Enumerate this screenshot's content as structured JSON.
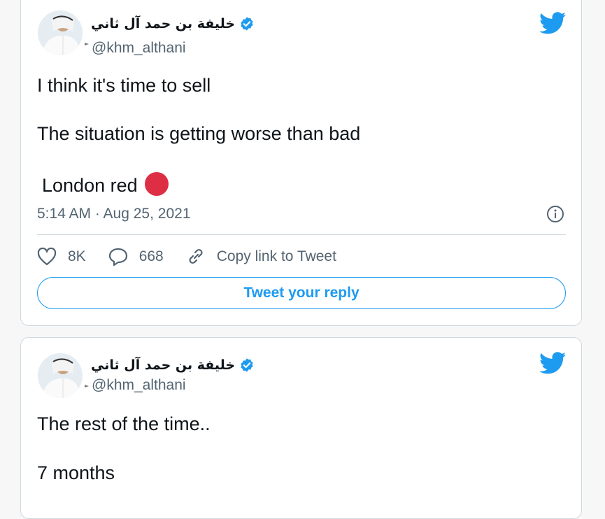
{
  "colors": {
    "accent": "#1d9bf0",
    "muted": "#536471",
    "red_circle": "#dd2e44"
  },
  "tweets": [
    {
      "author_name": "خليفة بن حمد آل ثاني",
      "handle": "@khm_althani",
      "lines": [
        "I think it's time to sell",
        "The situation is getting worse than bad",
        "London red"
      ],
      "emoji": "red-circle-emoji",
      "timestamp": "5:14 AM · Aug 25, 2021",
      "likes": "8K",
      "replies": "668",
      "copy_link_label": "Copy link to Tweet",
      "reply_button_label": "Tweet your reply"
    },
    {
      "author_name": "خليفة بن حمد آل ثاني",
      "handle": "@khm_althani",
      "lines": [
        "The rest of the time..",
        "7 months"
      ]
    }
  ],
  "icons": [
    "verified-badge-icon",
    "twitter-bird-icon",
    "info-icon",
    "heart-icon",
    "reply-icon",
    "link-icon"
  ]
}
